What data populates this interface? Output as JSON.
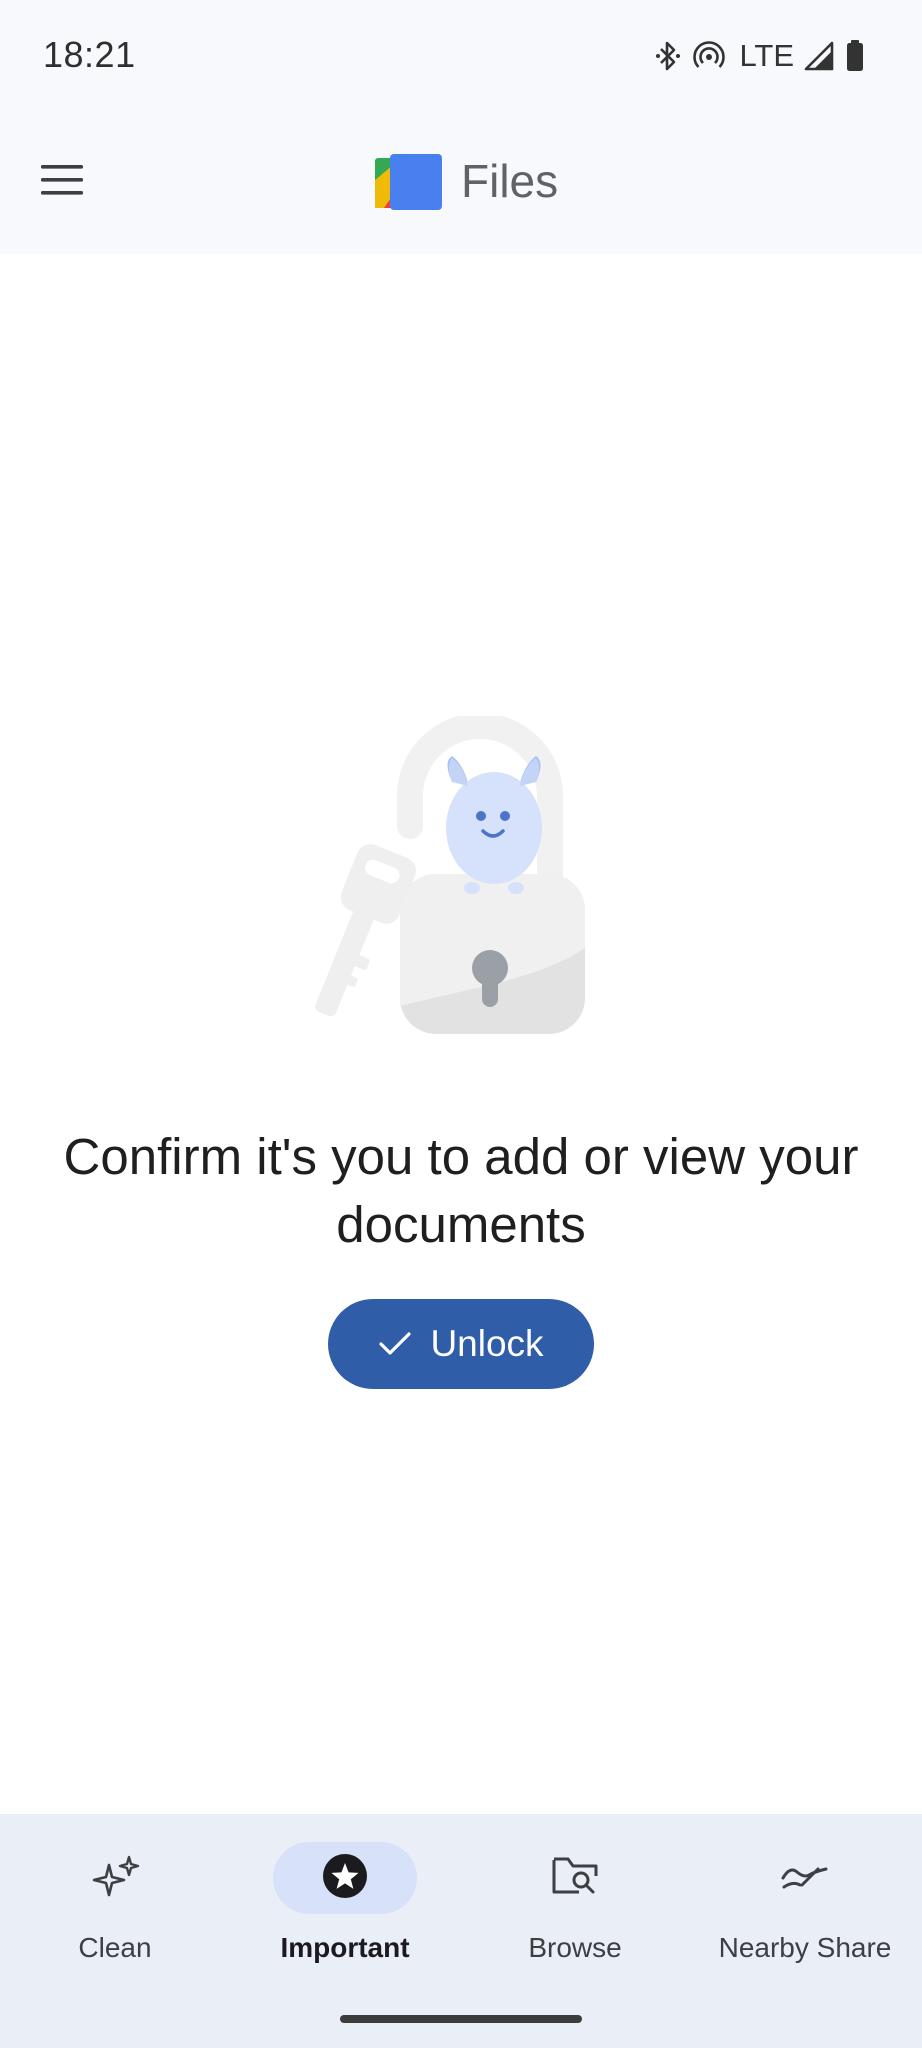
{
  "status_bar": {
    "time": "18:21",
    "network_label": "LTE",
    "icons": [
      "bluetooth-icon",
      "hotspot-icon",
      "signal-icon",
      "battery-icon"
    ]
  },
  "app_bar": {
    "title": "Files",
    "menu_icon": "menu-icon",
    "logo_icon": "files-logo-icon"
  },
  "main": {
    "illustration": "unlocked-padlock-illustration",
    "message": "Confirm it's you to add or view your documents",
    "unlock_button": {
      "label": "Unlock",
      "icon": "check-icon"
    }
  },
  "bottom_nav": {
    "items": [
      {
        "label": "Clean",
        "icon": "sparkle-icon",
        "active": false
      },
      {
        "label": "Important",
        "icon": "star-circle-icon",
        "active": true
      },
      {
        "label": "Browse",
        "icon": "folder-search-icon",
        "active": false
      },
      {
        "label": "Nearby Share",
        "icon": "nearby-share-icon",
        "active": false
      }
    ]
  },
  "colors": {
    "accent": "#2f5da8",
    "nav_background": "#eaeef7",
    "active_pill": "#d8e1fa",
    "app_bar_background": "#f8f9fc"
  }
}
